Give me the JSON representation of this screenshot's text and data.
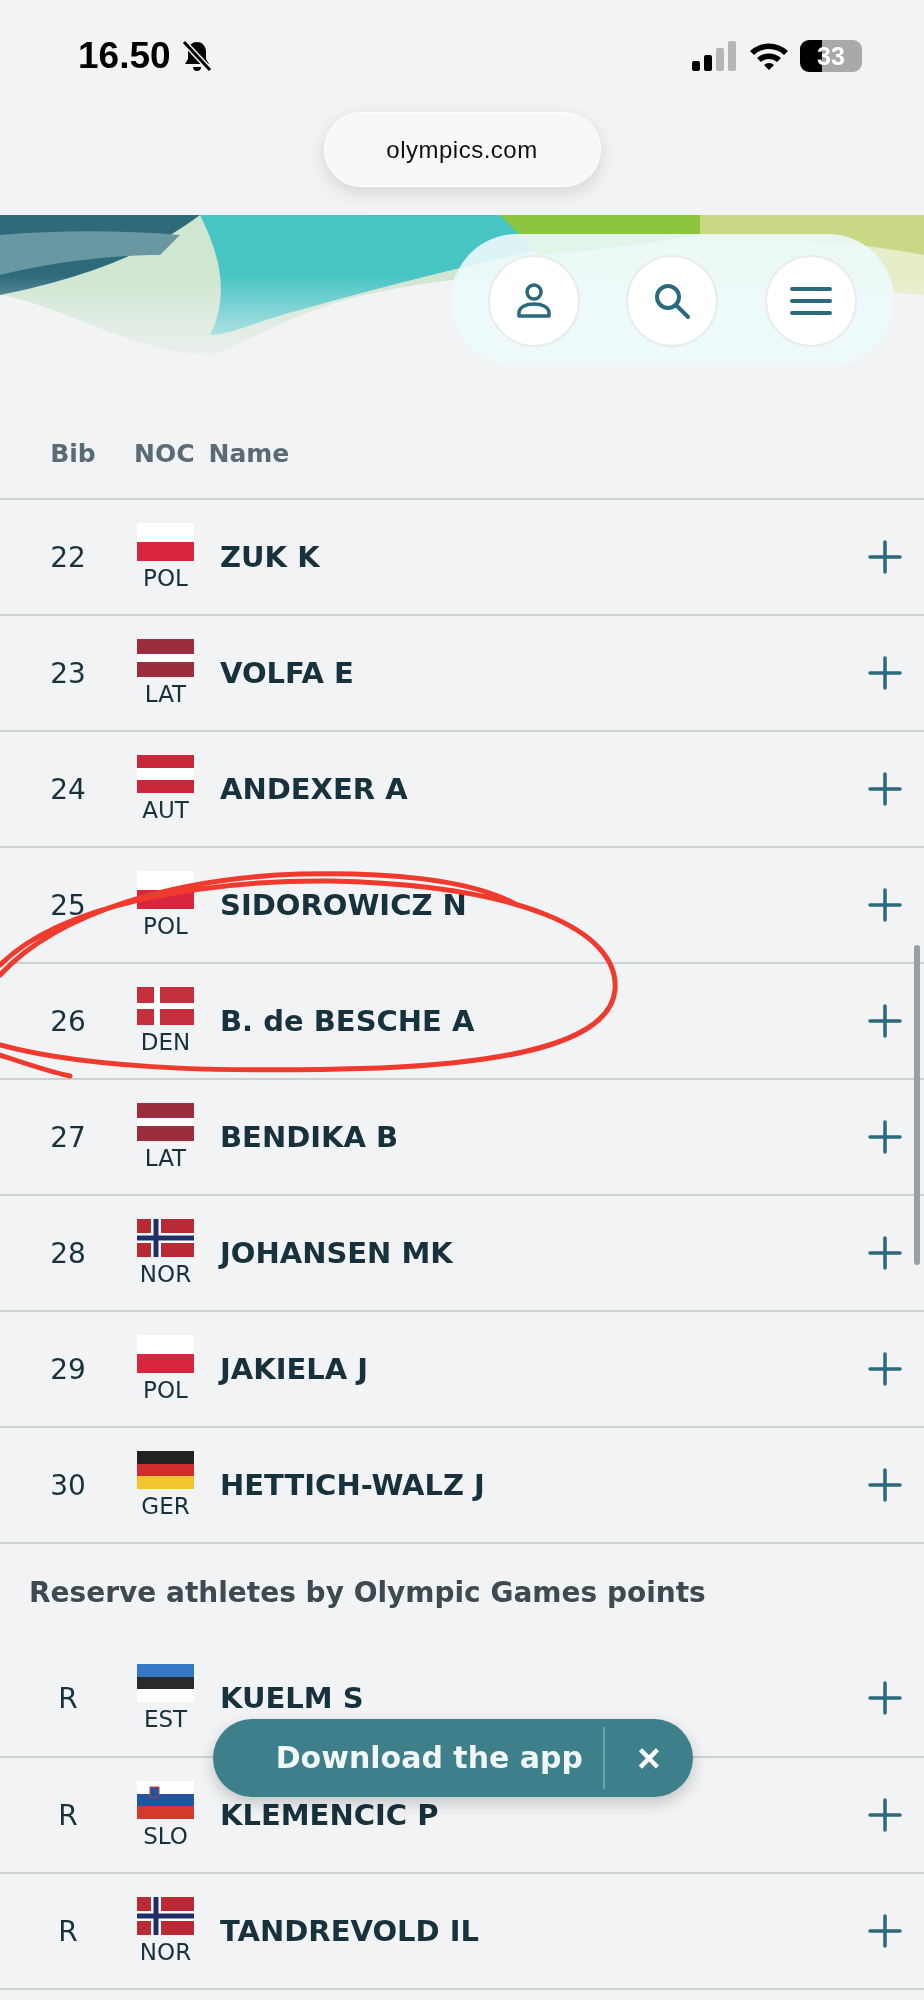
{
  "status_bar": {
    "time": "16.50",
    "battery": "33"
  },
  "browser": {
    "url": "olympics.com"
  },
  "table": {
    "columns": [
      "Bib",
      "NOC",
      "Name"
    ],
    "rows": [
      {
        "bib": "22",
        "kind": "poland",
        "noc": "POL",
        "name": "ZUK K"
      },
      {
        "bib": "23",
        "kind": "latvia",
        "noc": "LAT",
        "name": "VOLFA E"
      },
      {
        "bib": "24",
        "kind": "austria",
        "noc": "AUT",
        "name": "ANDEXER A"
      },
      {
        "bib": "25",
        "kind": "poland",
        "noc": "POL",
        "name": "SIDOROWICZ N"
      },
      {
        "bib": "26",
        "kind": "denmark",
        "noc": "DEN",
        "name": "B. de BESCHE A"
      },
      {
        "bib": "27",
        "kind": "latvia",
        "noc": "LAT",
        "name": "BENDIKA B"
      },
      {
        "bib": "28",
        "kind": "norway",
        "noc": "NOR",
        "name": "JOHANSEN MK"
      },
      {
        "bib": "29",
        "kind": "poland",
        "noc": "POL",
        "name": "JAKIELA J"
      },
      {
        "bib": "30",
        "kind": "germany",
        "noc": "GER",
        "name": "HETTICH-WALZ J"
      }
    ]
  },
  "reserve": {
    "title": "Reserve athletes by Olympic Games points",
    "rows": [
      {
        "bib": "R",
        "kind": "estonia",
        "noc": "EST",
        "name": "KUELM S"
      },
      {
        "bib": "R",
        "kind": "slovenia",
        "noc": "SLO",
        "name": "KLEMENCIC P"
      },
      {
        "bib": "R",
        "kind": "norway",
        "noc": "NOR",
        "name": "TANDREVOLD IL"
      }
    ]
  },
  "toast": {
    "label": "Download the app",
    "close": "×"
  }
}
